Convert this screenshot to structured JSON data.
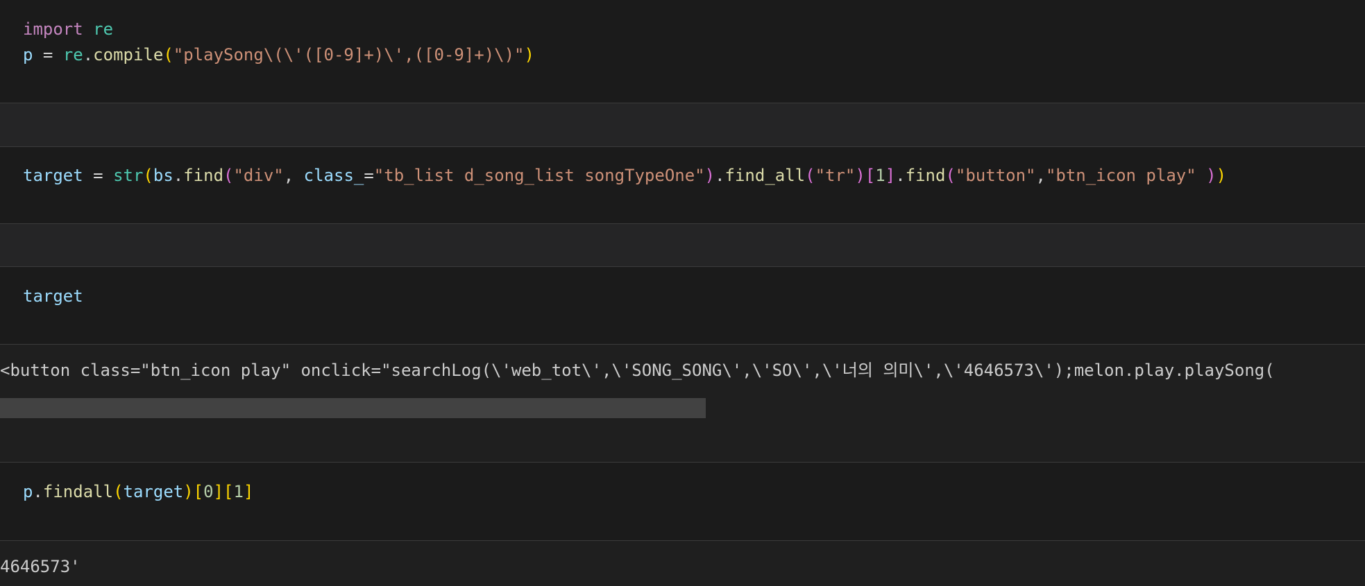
{
  "cells": [
    {
      "type": "code",
      "lines": [
        [
          {
            "t": "import",
            "c": "kw"
          },
          {
            "t": " ",
            "c": "op"
          },
          {
            "t": "re",
            "c": "mod"
          }
        ],
        [
          {
            "t": "p",
            "c": "var"
          },
          {
            "t": " = ",
            "c": "op"
          },
          {
            "t": "re",
            "c": "mod"
          },
          {
            "t": ".",
            "c": "op"
          },
          {
            "t": "compile",
            "c": "fn"
          },
          {
            "t": "(",
            "c": "p1"
          },
          {
            "t": "\"playSong\\(\\'([0-9]+)\\',([0-9]+)\\)\"",
            "c": "str"
          },
          {
            "t": ")",
            "c": "p1"
          }
        ]
      ]
    },
    {
      "type": "code",
      "lines": [
        [
          {
            "t": "target",
            "c": "var"
          },
          {
            "t": " = ",
            "c": "op"
          },
          {
            "t": "str",
            "c": "mod"
          },
          {
            "t": "(",
            "c": "p1"
          },
          {
            "t": "bs",
            "c": "var"
          },
          {
            "t": ".",
            "c": "op"
          },
          {
            "t": "find",
            "c": "fn"
          },
          {
            "t": "(",
            "c": "p2"
          },
          {
            "t": "\"div\"",
            "c": "str"
          },
          {
            "t": ", ",
            "c": "op"
          },
          {
            "t": "class_",
            "c": "var"
          },
          {
            "t": "=",
            "c": "op"
          },
          {
            "t": "\"tb_list d_song_list songTypeOne\"",
            "c": "str"
          },
          {
            "t": ")",
            "c": "p2"
          },
          {
            "t": ".",
            "c": "op"
          },
          {
            "t": "find_all",
            "c": "fn"
          },
          {
            "t": "(",
            "c": "p2"
          },
          {
            "t": "\"tr\"",
            "c": "str"
          },
          {
            "t": ")",
            "c": "p2"
          },
          {
            "t": "[",
            "c": "p2"
          },
          {
            "t": "1",
            "c": "num"
          },
          {
            "t": "]",
            "c": "p2"
          },
          {
            "t": ".",
            "c": "op"
          },
          {
            "t": "find",
            "c": "fn"
          },
          {
            "t": "(",
            "c": "p2"
          },
          {
            "t": "\"button\"",
            "c": "str"
          },
          {
            "t": ",",
            "c": "op"
          },
          {
            "t": "\"btn_icon play\"",
            "c": "str"
          },
          {
            "t": " ",
            "c": "op"
          },
          {
            "t": ")",
            "c": "p2"
          },
          {
            "t": ")",
            "c": "p1"
          }
        ]
      ]
    },
    {
      "type": "code",
      "lines": [
        [
          {
            "t": "target",
            "c": "var"
          }
        ]
      ]
    },
    {
      "type": "output",
      "text": "<button class=\"btn_icon play\" onclick=\"searchLog(\\'web_tot\\',\\'SONG_SONG\\',\\'SO\\',\\'너의 의미\\',\\'4646573\\');melon.play.playSong("
    },
    {
      "type": "code",
      "lines": [
        [
          {
            "t": "p",
            "c": "var"
          },
          {
            "t": ".",
            "c": "op"
          },
          {
            "t": "findall",
            "c": "fn"
          },
          {
            "t": "(",
            "c": "p1"
          },
          {
            "t": "target",
            "c": "var"
          },
          {
            "t": ")",
            "c": "p1"
          },
          {
            "t": "[",
            "c": "p1"
          },
          {
            "t": "0",
            "c": "num"
          },
          {
            "t": "]",
            "c": "p1"
          },
          {
            "t": "[",
            "c": "p1"
          },
          {
            "t": "1",
            "c": "num"
          },
          {
            "t": "]",
            "c": "p1"
          }
        ]
      ]
    },
    {
      "type": "output",
      "text": "4646573'"
    }
  ],
  "horizontal_scroll": {
    "thumb_fraction": 0.517
  }
}
